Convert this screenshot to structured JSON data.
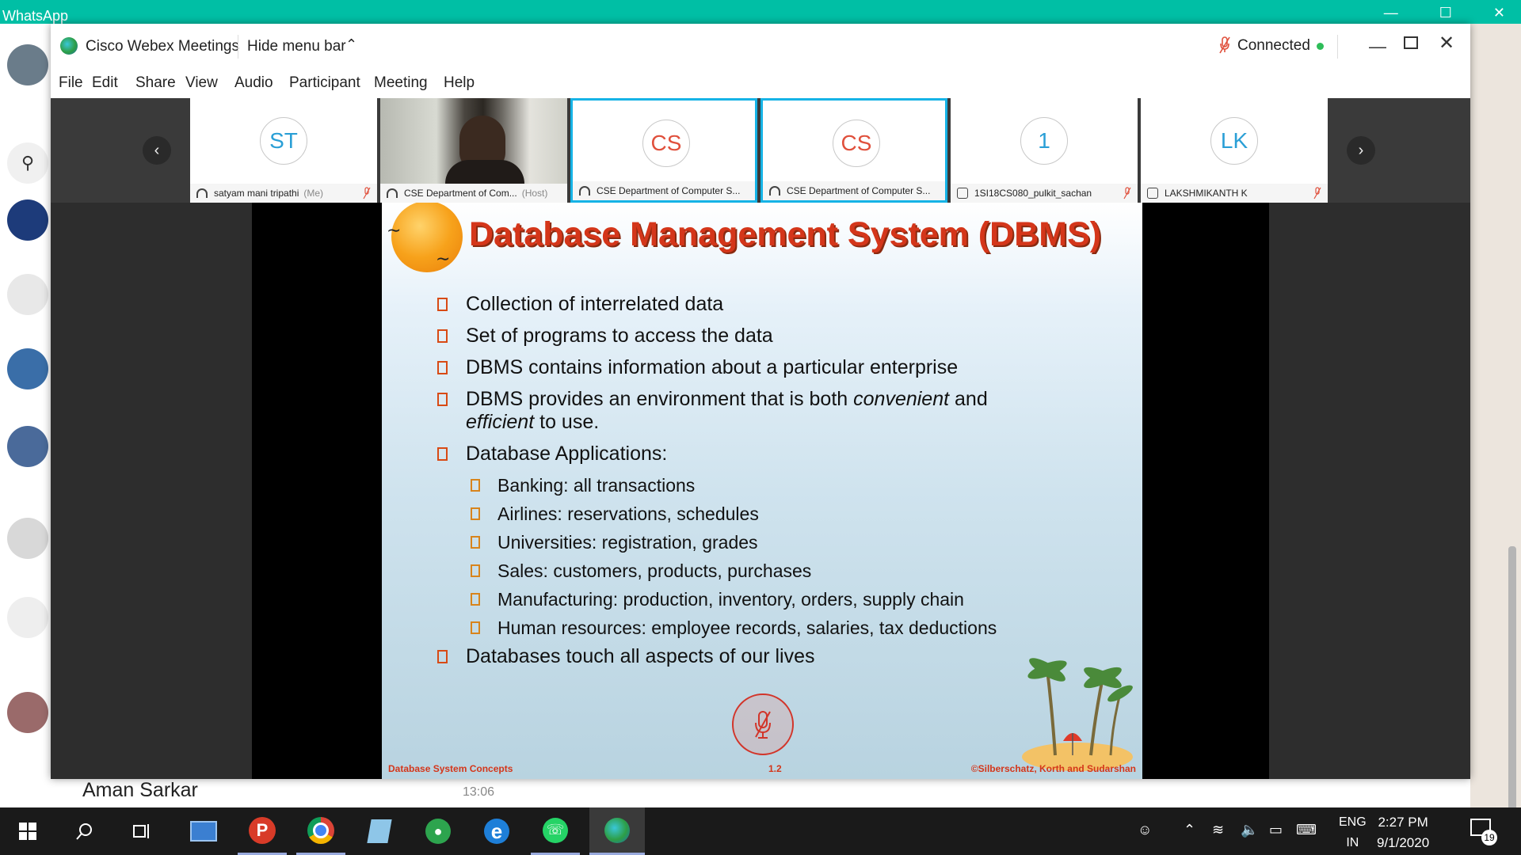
{
  "whatsapp": {
    "title": "WhatsApp",
    "chat_preview": {
      "name": "Aman Sarkar",
      "time": "13:06"
    }
  },
  "webex": {
    "app_title": "Cisco Webex Meetings",
    "hide_menu_label": "Hide menu bar",
    "status": "Connected",
    "menu": [
      "File",
      "Edit",
      "Share",
      "View",
      "Audio",
      "Participant",
      "Meeting",
      "Help"
    ],
    "participants": [
      {
        "initials": "ST",
        "name": "satyam mani tripathi",
        "tag": "(Me)",
        "initials_color": "#2a9fd6",
        "active": false,
        "muted": true
      },
      {
        "initials": "",
        "name": "CSE Department of Com...",
        "tag": "(Host)",
        "initials_color": "",
        "active": false,
        "muted": false
      },
      {
        "initials": "CS",
        "name": "CSE Department of Computer S...",
        "tag": "",
        "initials_color": "#e0503c",
        "active": true,
        "muted": false
      },
      {
        "initials": "CS",
        "name": "CSE Department of Computer S...",
        "tag": "",
        "initials_color": "#e0503c",
        "active": true,
        "muted": false
      },
      {
        "initials": "1",
        "name": "1SI18CS080_pulkit_sachan",
        "tag": "",
        "initials_color": "#2a9fd6",
        "active": false,
        "muted": true
      },
      {
        "initials": "LK",
        "name": "LAKSHMIKANTH K",
        "tag": "",
        "initials_color": "#2a9fd6",
        "active": false,
        "muted": true
      }
    ]
  },
  "slide": {
    "title": "Database Management System (DBMS)",
    "bullets": [
      "Collection of interrelated data",
      "Set of programs to access the data",
      "DBMS contains information about a particular enterprise"
    ],
    "bullet4_pre": "DBMS provides an environment that is both ",
    "bullet4_em1": "convenient",
    "bullet4_mid": " and",
    "bullet4_em2": "efficient",
    "bullet4_post": " to use.",
    "applications_heading": "Database Applications:",
    "applications": [
      "Banking: all transactions",
      "Airlines: reservations, schedules",
      "Universities:  registration, grades",
      "Sales: customers, products, purchases",
      "Manufacturing: production, inventory, orders, supply chain",
      "Human resources:  employee records, salaries, tax deductions"
    ],
    "last_bullet": "Databases touch all aspects of our lives",
    "footer_left": "Database System Concepts",
    "footer_center": "1.2",
    "footer_right": "©Silberschatz, Korth and Sudarshan"
  },
  "taskbar": {
    "lang_top": "ENG",
    "lang_bottom": "IN",
    "time": "2:27 PM",
    "date": "9/1/2020",
    "notifications": "19"
  },
  "icons": [
    "windows-icon",
    "search-icon",
    "task-view-icon",
    "laptop-icon",
    "pocket-icon",
    "chrome-icon",
    "notepad-icon",
    "gps-icon",
    "edge-icon",
    "whatsapp-icon",
    "webex-icon"
  ]
}
